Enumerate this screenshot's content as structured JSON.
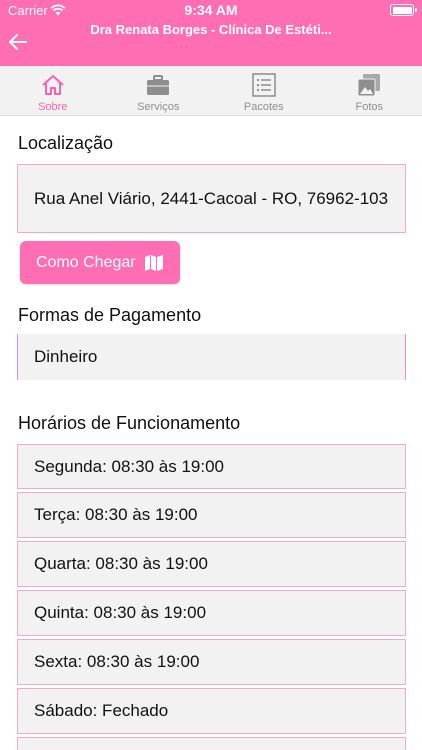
{
  "status_bar": {
    "carrier": "Carrier",
    "time": "9:34 AM"
  },
  "nav": {
    "title": "Dra Renata Borges - Clínica De Estéti..."
  },
  "tabs": [
    {
      "label": "Sobre",
      "icon": "home-icon",
      "active": true
    },
    {
      "label": "Serviços",
      "icon": "briefcase-icon",
      "active": false
    },
    {
      "label": "Pacotes",
      "icon": "list-icon",
      "active": false
    },
    {
      "label": "Fotos",
      "icon": "photos-icon",
      "active": false
    }
  ],
  "location": {
    "title": "Localização",
    "address": "Rua Anel Viário, 2441-Cacoal - RO, 76962-103",
    "directions_button": "Como Chegar"
  },
  "payment": {
    "title": "Formas de Pagamento",
    "methods": [
      "Dinheiro"
    ]
  },
  "hours": {
    "title": "Horários de Funcionamento",
    "days": [
      "Segunda: 08:30 às 19:00",
      "Terça: 08:30 às 19:00",
      "Quarta: 08:30 às 19:00",
      "Quinta: 08:30 às 19:00",
      "Sexta: 08:30 às 19:00",
      "Sábado: Fechado"
    ]
  },
  "colors": {
    "accent": "#ff6db3",
    "box_bg": "#f2f2f2",
    "border": "#f5a8cb",
    "tab_inactive": "#8e8e8e"
  }
}
